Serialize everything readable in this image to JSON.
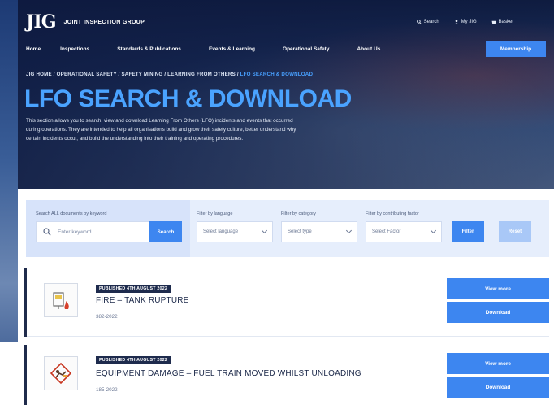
{
  "header": {
    "logo": "JIG",
    "logo_subtitle": "JOINT INSPECTION GROUP",
    "utility": {
      "search": "Search",
      "my_jig": "My JIG",
      "basket": "Basket"
    }
  },
  "nav": {
    "items": [
      "Home",
      "Inspections",
      "Standards & Publications",
      "Events & Learning",
      "Operational Safety",
      "About Us"
    ],
    "membership_label": "Membership"
  },
  "breadcrumb": {
    "path": "JIG HOME / OPERATIONAL SAFETY / SAFETY MINING / LEARNING FROM OTHERS / ",
    "current": "LFO SEARCH & DOWNLOAD"
  },
  "page": {
    "title": "LFO SEARCH & DOWNLOAD",
    "intro": "This section allows you to search, view and download Learning From Others (LFO) incidents and events that occurred during operations. They are intended to help all organisations build and grow their safety culture, better understand why certain incidents occur, and build the understanding into their training and operating procedures."
  },
  "filters": {
    "search_label": "Search ALL documents by keyword",
    "search_placeholder": "Enter keyword",
    "search_button": "Search",
    "language_label": "Filter by language",
    "language_value": "Select language",
    "category_label": "Filter by category",
    "category_value": "Select type",
    "factor_label": "Filter by contributing factor",
    "factor_value": "Select Factor",
    "filter_button": "Filter",
    "reset_button": "Reset"
  },
  "results": [
    {
      "badge": "PUBLISHED  4TH AUGUST 2022",
      "title": "FIRE  – TANK RUPTURE",
      "ref": "382-2022",
      "view_label": "View more",
      "download_label": "Download",
      "icon": "fire-tank-icon"
    },
    {
      "badge": "PUBLISHED  4TH AUGUST 2022",
      "title": "EQUIPMENT DAMAGE – FUEL TRAIN MOVED WHILST UNLOADING",
      "ref": "185-2022",
      "view_label": "View more",
      "download_label": "Download",
      "icon": "equipment-damage-icon"
    }
  ],
  "colors": {
    "accent": "#3d86f0",
    "title_blue": "#4aa3ff",
    "navy": "#1e2b4d",
    "panel": "#e6eefc"
  }
}
